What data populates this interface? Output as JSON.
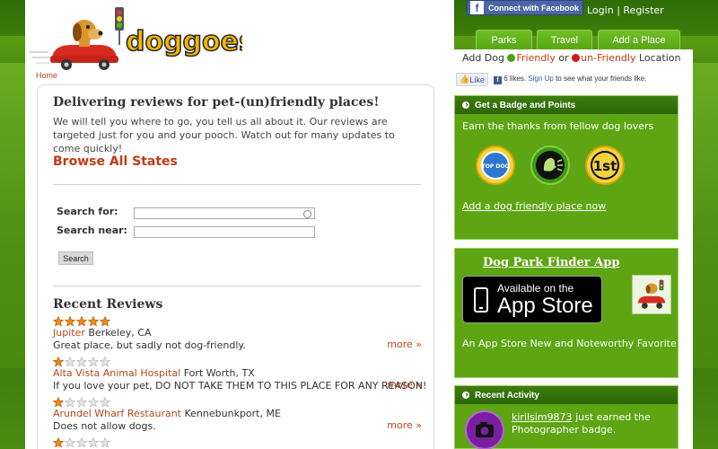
{
  "brand": {
    "logo_text": "doggoes"
  },
  "header": {
    "facebook_connect_label": "Connect with Facebook",
    "login_label": "Login",
    "separator": "|",
    "register_label": "Register",
    "nav_tabs": [
      {
        "label": "Parks"
      },
      {
        "label": "Travel"
      },
      {
        "label": "Add a Place"
      }
    ]
  },
  "breadcrumb": {
    "home": "Home"
  },
  "main": {
    "headline": "Delivering reviews for pet-(un)friendly places!",
    "intro": "We will tell you where to go, you tell us all about it. Our reviews are targeted just for you and your pooch. Watch out for many updates to come quickly!",
    "browse_link": "Browse All States",
    "search": {
      "for_label": "Search for:",
      "for_value": "",
      "near_label": "Search near:",
      "near_value": "",
      "button_label": "Search"
    },
    "recent_reviews_title": "Recent Reviews",
    "reviews": [
      {
        "rating": 5,
        "place": "Jupiter",
        "location": "Berkeley, CA",
        "text": "Great place, but sadly not dog-friendly.",
        "more": "more »"
      },
      {
        "rating": 1,
        "place": "Alta Vista Animal Hospital",
        "location": "Fort Worth, TX",
        "text": "If you love your pet, DO NOT TAKE THEM TO THIS PLACE FOR ANY REASON!",
        "more": "more »"
      },
      {
        "rating": 1,
        "place": "Arundel Wharf Restaurant",
        "location": "Kennebunkport, ME",
        "text": "Does not allow dogs.",
        "more": "more »"
      },
      {
        "rating": 1
      }
    ]
  },
  "sidebar": {
    "add_location": {
      "prefix": "Add Dog",
      "friendly": "Friendly",
      "or": "or",
      "unfriendly": "un-Friendly",
      "suffix": "Location"
    },
    "facebook_like": {
      "button": "Like",
      "count_text": "6 likes.",
      "signup": "Sign Up",
      "rest": "to see what your friends like."
    },
    "badges_panel": {
      "title": "Get a Badge and Points",
      "subtitle": "Earn the thanks from fellow dog lovers",
      "badges": [
        {
          "icon": "top-dog-badge",
          "text": "TOP DOG"
        },
        {
          "icon": "speak-badge"
        },
        {
          "icon": "first-badge",
          "text": "1st"
        }
      ],
      "link": "Add a dog friendly place now"
    },
    "app_panel": {
      "title": "Dog Park Finder App",
      "store_line1": "Available on the",
      "store_line2": "App Store",
      "note": "An App Store New and Noteworthy Favorite"
    },
    "activity_panel": {
      "title": "Recent Activity",
      "user": "kirilsim9873",
      "text": "just earned the Photographer badge."
    }
  },
  "colors": {
    "green_dark": "#2e6608",
    "green_panel": "#5da512",
    "accent_red": "#c43a12",
    "link_brown": "#b5471c",
    "star_orange": "#f08a1c"
  }
}
